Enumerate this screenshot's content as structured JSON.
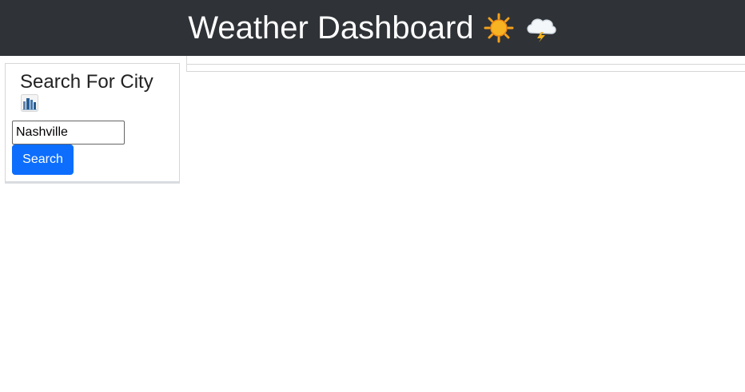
{
  "header": {
    "title": "Weather Dashboard",
    "icons": [
      "sun-icon",
      "storm-cloud-icon"
    ]
  },
  "search_panel": {
    "title": "Search For City",
    "icon": "city-icon",
    "input_value": "Nashville",
    "button_label": "Search"
  },
  "colors": {
    "header_background": "#2f3337",
    "header_text": "#ffffff",
    "button_primary": "#0d6efd",
    "panel_border": "#d7d7d7"
  }
}
